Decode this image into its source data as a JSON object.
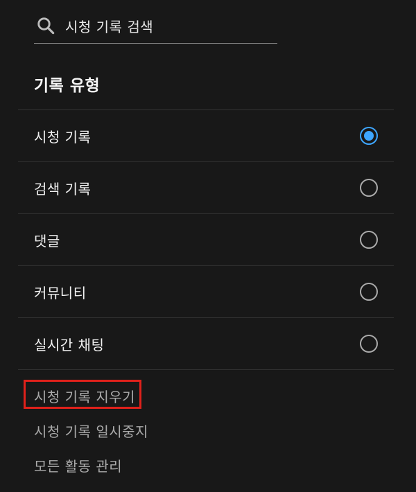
{
  "search": {
    "label": "시청 기록 검색",
    "icon": "search-icon"
  },
  "section": {
    "title": "기록 유형"
  },
  "history_types": [
    {
      "label": "시청 기록",
      "selected": true
    },
    {
      "label": "검색 기록",
      "selected": false
    },
    {
      "label": "댓글",
      "selected": false
    },
    {
      "label": "커뮤니티",
      "selected": false
    },
    {
      "label": "실시간 채팅",
      "selected": false
    }
  ],
  "actions": [
    {
      "label": "시청 기록 지우기",
      "highlighted": true
    },
    {
      "label": "시청 기록 일시중지",
      "highlighted": false
    },
    {
      "label": "모든 활동 관리",
      "highlighted": false
    }
  ],
  "colors": {
    "background": "#181818",
    "accent": "#3ea6ff",
    "highlight": "#e0211b",
    "divider": "#333333"
  }
}
